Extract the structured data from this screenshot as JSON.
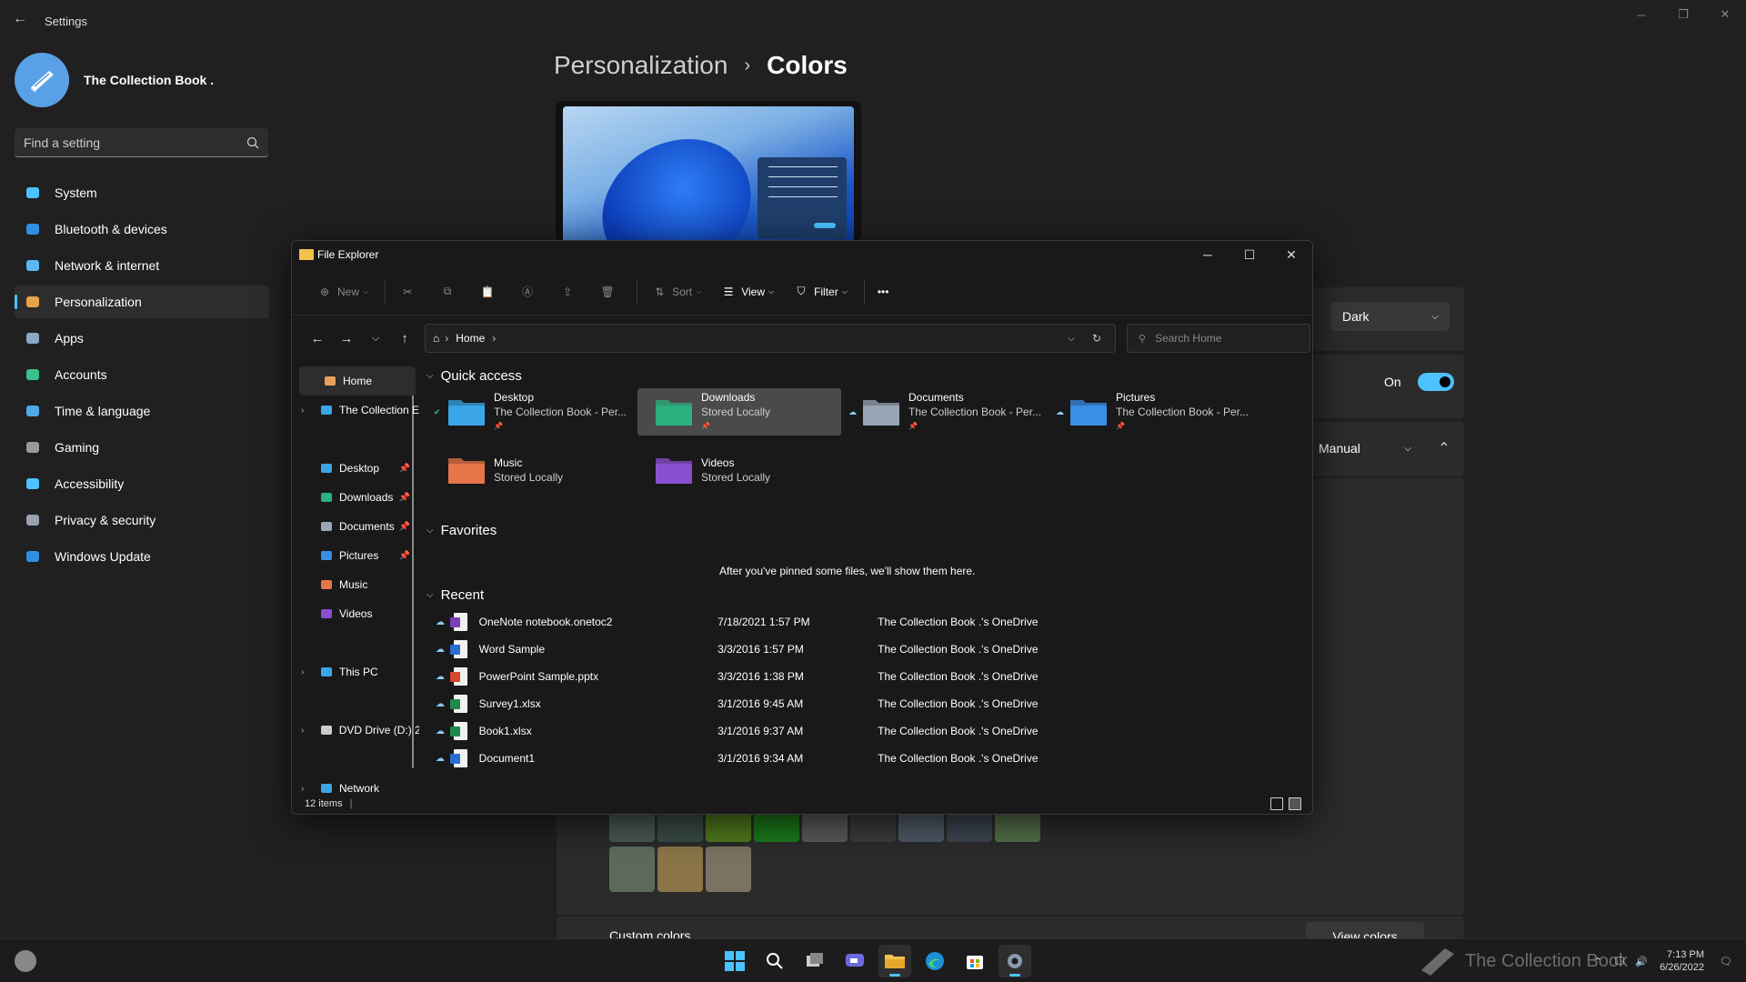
{
  "settings": {
    "app_title": "Settings",
    "profile_name": "The Collection Book .",
    "search_placeholder": "Find a setting",
    "nav": [
      {
        "label": "System",
        "icon": "monitor-icon",
        "color": "#4cc2ff"
      },
      {
        "label": "Bluetooth & devices",
        "icon": "bluetooth-icon",
        "color": "#2f8fe6"
      },
      {
        "label": "Network & internet",
        "icon": "wifi-icon",
        "color": "#5ab8f5"
      },
      {
        "label": "Personalization",
        "icon": "brush-icon",
        "color": "#e7a34a"
      },
      {
        "label": "Apps",
        "icon": "apps-icon",
        "color": "#8ca8c9"
      },
      {
        "label": "Accounts",
        "icon": "person-icon",
        "color": "#3bbf8a"
      },
      {
        "label": "Time & language",
        "icon": "globe-clock-icon",
        "color": "#4ea9e8"
      },
      {
        "label": "Gaming",
        "icon": "gamepad-icon",
        "color": "#9a9a9a"
      },
      {
        "label": "Accessibility",
        "icon": "accessibility-icon",
        "color": "#4cc2ff"
      },
      {
        "label": "Privacy & security",
        "icon": "shield-icon",
        "color": "#9aa3ad"
      },
      {
        "label": "Windows Update",
        "icon": "update-icon",
        "color": "#2f8fe6"
      }
    ],
    "breadcrumb": {
      "parent": "Personalization",
      "separator": "›",
      "current": "Colors"
    },
    "mode_dropdown": "Dark",
    "transparency": "On",
    "accent_dropdown": "Manual",
    "custom_colors_label": "Custom colors",
    "view_colors_button": "View colors",
    "swatches_row1": [
      "#4a5a52",
      "#3c4c46",
      "#4f7a1c",
      "#1b7a1b",
      "#5b5b5b",
      "#3c3c3c",
      "#4f5a66",
      "#3c4550",
      "#54704a"
    ],
    "swatches_row2": [
      "#5c6a5c",
      "#8a7448",
      "#7c7262"
    ],
    "accent_color": "#4cc2ff"
  },
  "explorer": {
    "title": "File Explorer",
    "toolbar": {
      "new": "New",
      "sort": "Sort",
      "view": "View",
      "filter": "Filter",
      "more": "•••"
    },
    "address": {
      "root": "Home"
    },
    "search_placeholder": "Search Home",
    "tree": [
      {
        "label": "Home",
        "icon": "home-icon",
        "selected": true
      },
      {
        "label": "The Collection E",
        "icon": "onedrive-icon",
        "expandable": true
      },
      {
        "label": "Desktop",
        "icon": "desktop-folder-icon",
        "pinned": true
      },
      {
        "label": "Downloads",
        "icon": "downloads-folder-icon",
        "pinned": true
      },
      {
        "label": "Documents",
        "icon": "documents-folder-icon",
        "pinned": true
      },
      {
        "label": "Pictures",
        "icon": "pictures-folder-icon",
        "pinned": true
      },
      {
        "label": "Music",
        "icon": "music-folder-icon"
      },
      {
        "label": "Videos",
        "icon": "videos-folder-icon"
      },
      {
        "label": "This PC",
        "icon": "pc-icon",
        "expandable": true
      },
      {
        "label": "DVD Drive (D:) 2",
        "icon": "dvd-icon",
        "expandable": true
      },
      {
        "label": "Network",
        "icon": "network-icon",
        "expandable": true
      }
    ],
    "quick_access_header": "Quick access",
    "quick_access": [
      {
        "name": "Desktop",
        "sub": "The Collection Book - Per...",
        "icon": "desktop-folder-icon",
        "color": "#3aa6e8",
        "status": "✔"
      },
      {
        "name": "Downloads",
        "sub": "Stored Locally",
        "icon": "downloads-folder-icon",
        "color": "#2bb07f",
        "status": "",
        "selected": true
      },
      {
        "name": "Documents",
        "sub": "The Collection Book - Per...",
        "icon": "documents-folder-icon",
        "color": "#9aa6b5",
        "status": "☁"
      },
      {
        "name": "Pictures",
        "sub": "The Collection Book - Per...",
        "icon": "pictures-folder-icon",
        "color": "#3a8ee8",
        "status": "☁"
      },
      {
        "name": "Music",
        "sub": "Stored Locally",
        "icon": "music-folder-icon",
        "color": "#e8744a",
        "status": ""
      },
      {
        "name": "Videos",
        "sub": "Stored Locally",
        "icon": "videos-folder-icon",
        "color": "#8a4fd1",
        "status": ""
      }
    ],
    "favorites_header": "Favorites",
    "favorites_empty": "After you've pinned some files, we'll show them here.",
    "recent_header": "Recent",
    "recent": [
      {
        "name": "OneNote notebook.onetoc2",
        "date": "7/18/2021 1:57 PM",
        "location": "The Collection Book .'s OneDrive",
        "icon": "onenote-file-icon",
        "color": "#7b3fb5"
      },
      {
        "name": "Word Sample",
        "date": "3/3/2016 1:57 PM",
        "location": "The Collection Book .'s OneDrive",
        "icon": "word-file-icon",
        "color": "#2b6cd1"
      },
      {
        "name": "PowerPoint Sample.pptx",
        "date": "3/3/2016 1:38 PM",
        "location": "The Collection Book .'s OneDrive",
        "icon": "powerpoint-file-icon",
        "color": "#d24a2a"
      },
      {
        "name": "Survey1.xlsx",
        "date": "3/1/2016 9:45 AM",
        "location": "The Collection Book .'s OneDrive",
        "icon": "excel-file-icon",
        "color": "#1f8a4c"
      },
      {
        "name": "Book1.xlsx",
        "date": "3/1/2016 9:37 AM",
        "location": "The Collection Book .'s OneDrive",
        "icon": "excel-file-icon",
        "color": "#1f8a4c"
      },
      {
        "name": "Document1",
        "date": "3/1/2016 9:34 AM",
        "location": "The Collection Book .'s OneDrive",
        "icon": "word-file-icon",
        "color": "#2b6cd1"
      }
    ],
    "status_items": "12 items"
  },
  "taskbar": {
    "time": "7:13 PM",
    "date": "6/26/2022",
    "watermark": "The Collection Book"
  }
}
